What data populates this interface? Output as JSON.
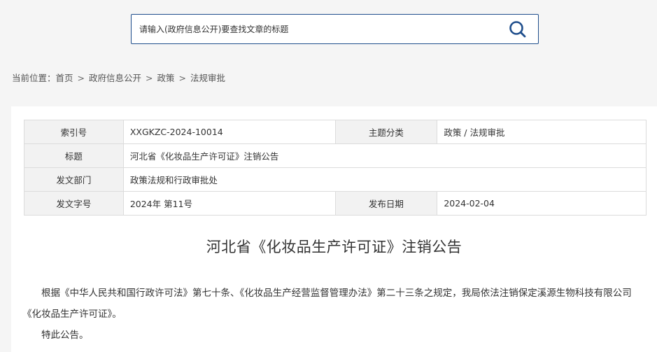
{
  "search": {
    "placeholder": "请输入(政府信息公开)要查找文章的标题"
  },
  "breadcrumb": {
    "prefix": "当前位置：",
    "separator": ">",
    "items": [
      "首页",
      "政府信息公开",
      "政策",
      "法规审批"
    ]
  },
  "meta": {
    "index_label": "索引号",
    "index_value": "XXGKZC-2024-10014",
    "category_label": "主题分类",
    "category_value": "政策 / 法规审批",
    "title_label": "标题",
    "title_value": "河北省《化妆品生产许可证》注销公告",
    "dept_label": "发文部门",
    "dept_value": "政策法规和行政审批处",
    "docno_label": "发文字号",
    "docno_value": "2024年 第11号",
    "date_label": "发布日期",
    "date_value": "2024-02-04"
  },
  "article": {
    "title": "河北省《化妆品生产许可证》注销公告",
    "paragraphs": [
      "根据《中华人民共和国行政许可法》第七十条、《化妆品生产经营监督管理办法》第二十三条之规定，我局依法注销保定溪源生物科技有限公司《化妆品生产许可证》。",
      "特此公告。"
    ]
  },
  "colors": {
    "accent": "#1f4e8c",
    "page_bg": "#f5f5f5",
    "label_bg": "#f2f2f2"
  },
  "icons": {
    "search": "search-icon"
  }
}
